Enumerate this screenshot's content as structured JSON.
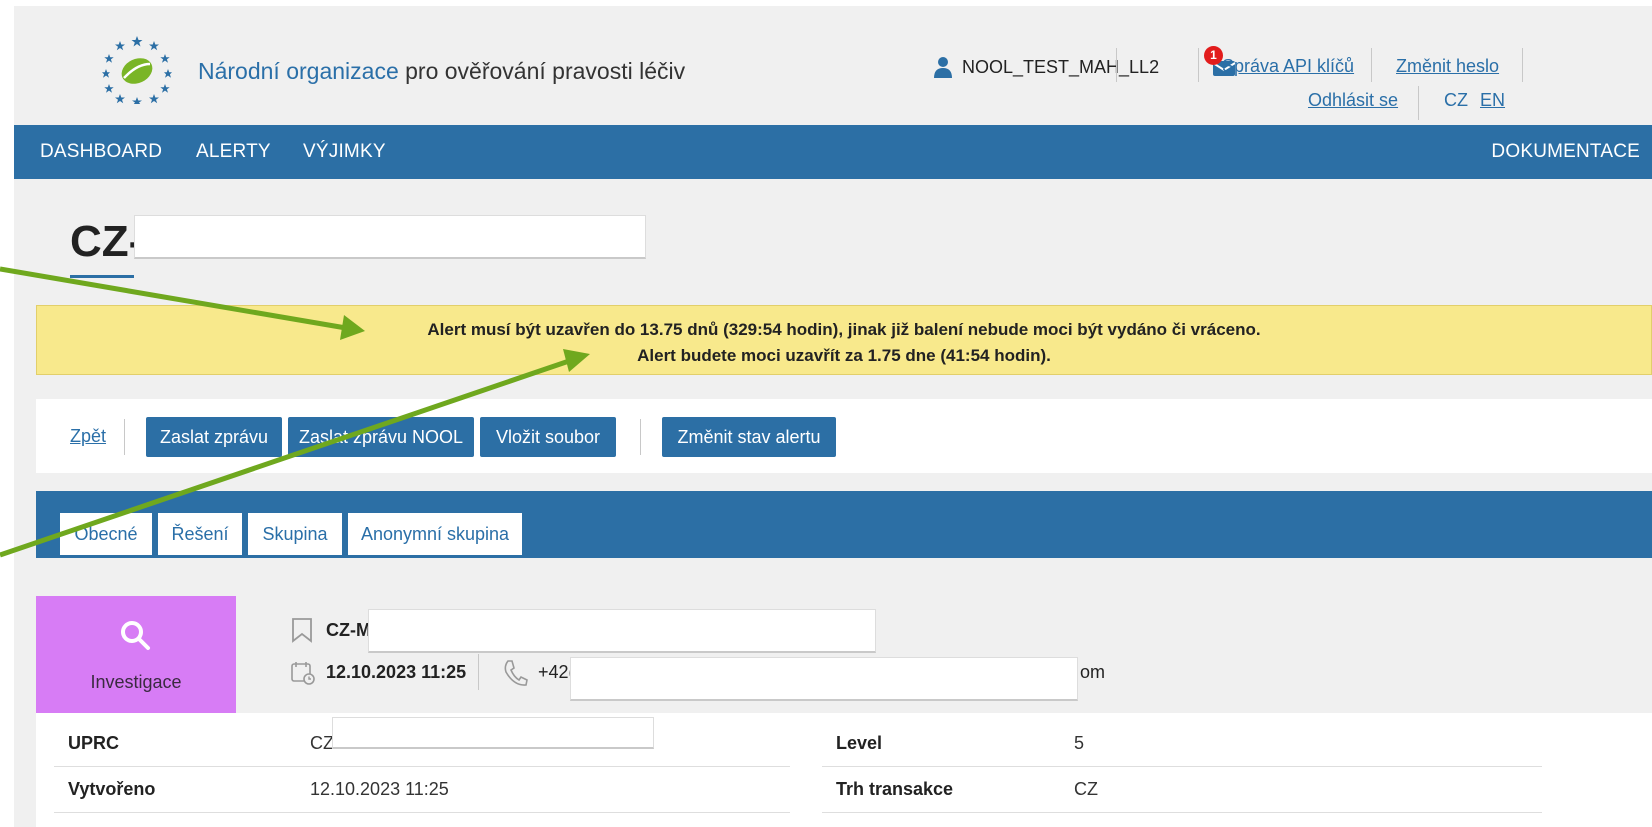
{
  "header": {
    "org_name_highlight": "Národní organizace",
    "org_name_rest": " pro ověřování pravosti léčiv",
    "username": "NOOL_TEST_MAH_LL2",
    "notification_count": "1",
    "api_keys_link": "Správa API klíčů",
    "change_password_link": "Změnit heslo",
    "logout_link": "Odhlásit se",
    "lang_cz": "CZ",
    "lang_en": "EN"
  },
  "nav": {
    "items": [
      "DASHBOARD",
      "ALERTY",
      "VÝJIMKY"
    ],
    "right_item": "DOKUMENTACE"
  },
  "page": {
    "title_prefix": "CZ-I"
  },
  "alert": {
    "line1": "Alert musí být uzavřen do 13.75 dnů (329:54 hodin), jinak již balení nebude moci být vydáno či vráceno.",
    "line2": "Alert budete moci uzavřít za 1.75 dne (41:54 hodin)."
  },
  "actions": {
    "back": "Zpět",
    "send_message": "Zaslat zprávu",
    "send_message_nool": "Zaslat zprávu NOOL",
    "upload_file": "Vložit soubor",
    "change_state": "Změnit stav alertu"
  },
  "tabs": [
    "Obecné",
    "Řešení",
    "Skupina",
    "Anonymní skupina"
  ],
  "status": {
    "label": "Investigace",
    "color": "#d77cf5"
  },
  "summary": {
    "id_prefix": "CZ-M",
    "created": "12.10.2023 11:25",
    "phone_prefix": "+42(",
    "email_suffix": "om"
  },
  "details": {
    "left": [
      {
        "label": "UPRC",
        "value": "CZ-"
      },
      {
        "label": "Vytvořeno",
        "value": "12.10.2023 11:25"
      }
    ],
    "right": [
      {
        "label": "Level",
        "value": "5"
      },
      {
        "label": "Trh transakce",
        "value": "CZ"
      }
    ]
  },
  "colors": {
    "primary": "#2c6fa5",
    "alert_bg": "#f8e98c",
    "badge": "#e21c1c",
    "annotation_arrow": "#6fa81e"
  }
}
